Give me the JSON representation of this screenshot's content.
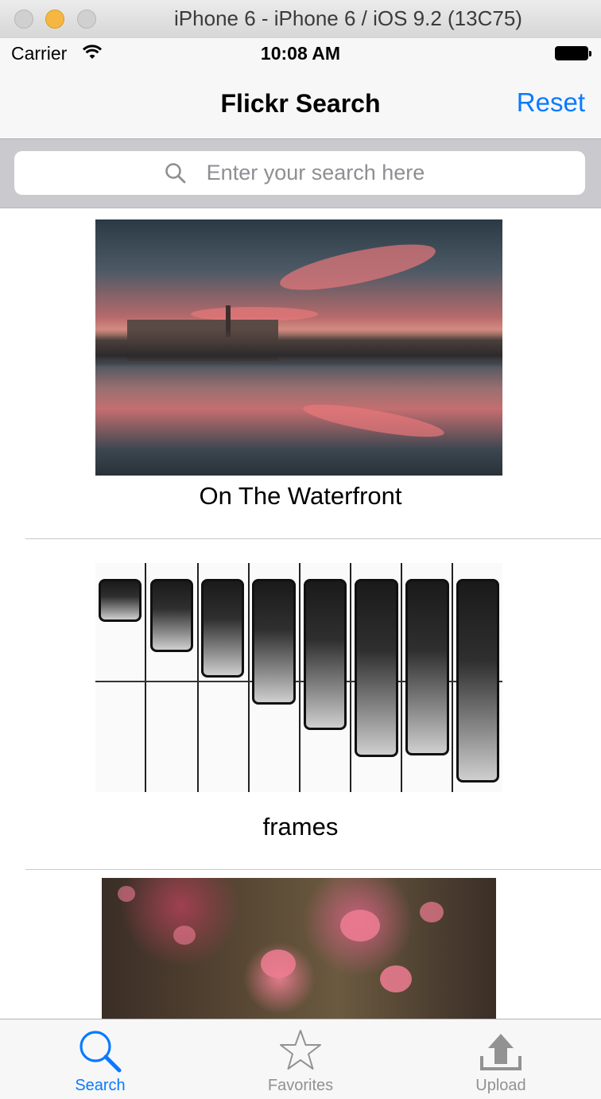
{
  "window": {
    "title": "iPhone 6 - iPhone 6 / iOS 9.2 (13C75)"
  },
  "status_bar": {
    "carrier": "Carrier",
    "time": "10:08 AM"
  },
  "nav": {
    "title": "Flickr Search",
    "reset_label": "Reset"
  },
  "search": {
    "placeholder": "Enter your search here",
    "value": ""
  },
  "results": [
    {
      "caption": "On The Waterfront"
    },
    {
      "caption": "frames"
    },
    {
      "caption": ""
    }
  ],
  "tabs": [
    {
      "label": "Search",
      "icon": "search-icon",
      "selected": true
    },
    {
      "label": "Favorites",
      "icon": "star-icon",
      "selected": false
    },
    {
      "label": "Upload",
      "icon": "upload-icon",
      "selected": false
    }
  ],
  "colors": {
    "accent": "#0a7aff",
    "tab_inactive": "#929292"
  }
}
